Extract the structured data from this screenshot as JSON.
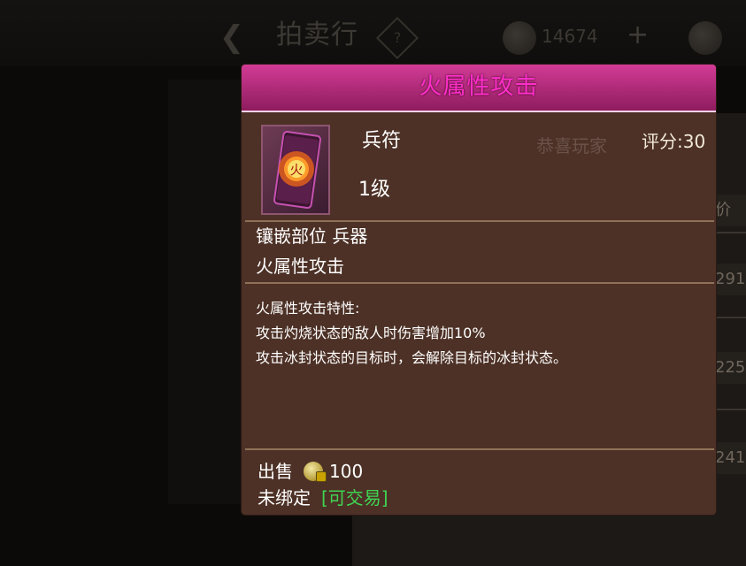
{
  "background": {
    "title": "拍卖行",
    "gold_amount": "14674",
    "back_icon": "chevron-left-icon",
    "help_icon": "question-icon",
    "plus_icon": "plus-icon",
    "rows": [
      "291",
      "225",
      "241"
    ],
    "column_hint": "价"
  },
  "tooltip": {
    "title": "火属性攻击",
    "item_name": "兵符",
    "level": "1级",
    "faded_text": "恭喜玩家",
    "score": "评分:30",
    "slot": "镶嵌部位  兵器",
    "attribute": "火属性攻击",
    "description": [
      "火属性攻击特性:",
      "攻击灼烧状态的敌人时伤害增加10%",
      "攻击冰封状态的目标时，会解除目标的冰封状态。"
    ],
    "sell_label": "出售",
    "sell_price": "100",
    "bind_status": "未绑定",
    "tradable": "[可交易]",
    "icon": "fire-talisman-icon",
    "colors": {
      "title": "#ff2fc8",
      "header": "#b42a7c",
      "body": "#4d3126",
      "tradable": "#3fd452"
    }
  }
}
